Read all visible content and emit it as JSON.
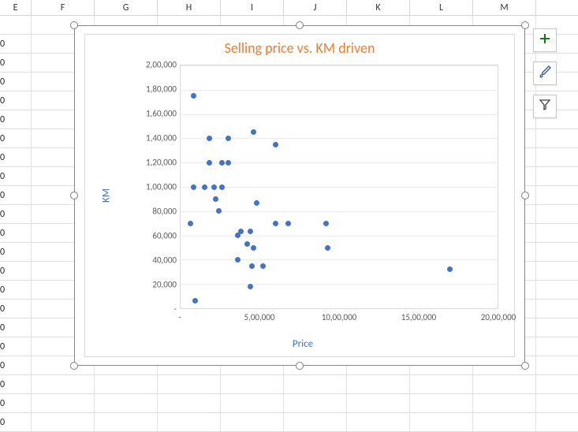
{
  "columns": [
    {
      "label": "E",
      "width": 40
    },
    {
      "label": "F",
      "width": 80
    },
    {
      "label": "G",
      "width": 80
    },
    {
      "label": "H",
      "width": 80
    },
    {
      "label": "I",
      "width": 80
    },
    {
      "label": "J",
      "width": 80
    },
    {
      "label": "K",
      "width": 80
    },
    {
      "label": "L",
      "width": 80
    },
    {
      "label": "M",
      "width": 80
    }
  ],
  "partial_col_e_value": "0",
  "row_count": 22,
  "chart_buttons": [
    {
      "name": "chart-elements",
      "icon": "plus",
      "stroke": "#107c10"
    },
    {
      "name": "chart-styles",
      "icon": "brush",
      "stroke": "#2b579a"
    },
    {
      "name": "chart-filters",
      "icon": "funnel",
      "stroke": "#404040"
    }
  ],
  "chart_data": {
    "type": "scatter",
    "title": "Selling price vs. KM driven",
    "xlabel": "Price",
    "ylabel": "KM",
    "xlim": [
      0,
      2000000
    ],
    "ylim": [
      0,
      200000
    ],
    "x_ticks": [
      "-",
      "5,00,000",
      "10,00,000",
      "15,00,000",
      "20,00,000"
    ],
    "x_tick_vals": [
      0,
      500000,
      1000000,
      1500000,
      2000000
    ],
    "y_ticks": [
      "-",
      "20,000",
      "40,000",
      "60,000",
      "80,000",
      "1,00,000",
      "1,20,000",
      "1,40,000",
      "1,60,000",
      "1,80,000",
      "2,00,000"
    ],
    "y_tick_vals": [
      0,
      20000,
      40000,
      60000,
      80000,
      100000,
      120000,
      140000,
      160000,
      180000,
      200000
    ],
    "points": [
      {
        "x": 80000,
        "y": 175000
      },
      {
        "x": 180000,
        "y": 140000
      },
      {
        "x": 300000,
        "y": 140000
      },
      {
        "x": 460000,
        "y": 145000
      },
      {
        "x": 600000,
        "y": 135000
      },
      {
        "x": 180000,
        "y": 120000
      },
      {
        "x": 260000,
        "y": 120000
      },
      {
        "x": 300000,
        "y": 120000
      },
      {
        "x": 80000,
        "y": 100000
      },
      {
        "x": 150000,
        "y": 100000
      },
      {
        "x": 210000,
        "y": 100000
      },
      {
        "x": 260000,
        "y": 100000
      },
      {
        "x": 220000,
        "y": 90000
      },
      {
        "x": 480000,
        "y": 87000
      },
      {
        "x": 240000,
        "y": 80000
      },
      {
        "x": 60000,
        "y": 70000
      },
      {
        "x": 600000,
        "y": 70000
      },
      {
        "x": 680000,
        "y": 70000
      },
      {
        "x": 920000,
        "y": 70000
      },
      {
        "x": 380000,
        "y": 63000
      },
      {
        "x": 440000,
        "y": 63000
      },
      {
        "x": 360000,
        "y": 60000
      },
      {
        "x": 420000,
        "y": 53000
      },
      {
        "x": 460000,
        "y": 50000
      },
      {
        "x": 930000,
        "y": 50000
      },
      {
        "x": 360000,
        "y": 40000
      },
      {
        "x": 450000,
        "y": 35000
      },
      {
        "x": 520000,
        "y": 35000
      },
      {
        "x": 1700000,
        "y": 32000
      },
      {
        "x": 440000,
        "y": 18000
      },
      {
        "x": 90000,
        "y": 6000
      }
    ]
  }
}
